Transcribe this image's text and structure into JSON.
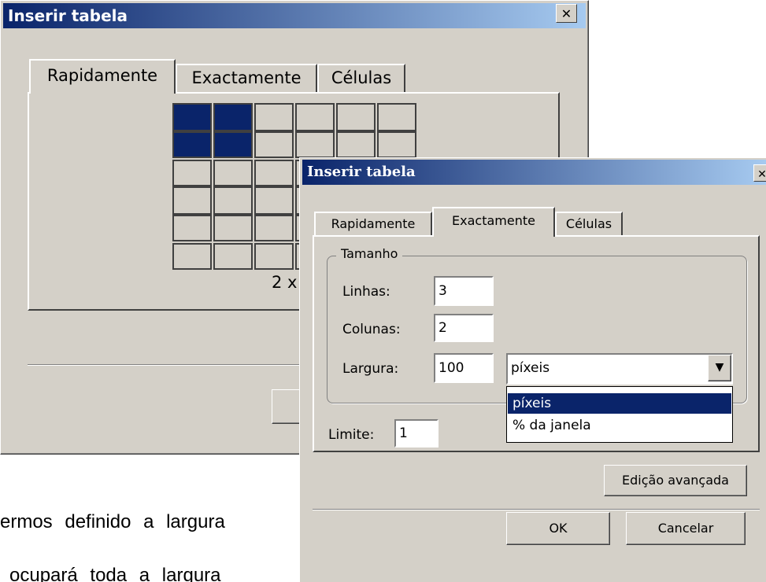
{
  "dialog1": {
    "title": "Inserir tabela",
    "close_glyph": "✕",
    "tabs": [
      "Rapidamente",
      "Exactamente",
      "Células"
    ],
    "grid_rows": 6,
    "grid_cols": 6,
    "selected_rows": 2,
    "selected_cols": 2,
    "size_label": "2 x"
  },
  "dialog2": {
    "title": "Inserir tabela",
    "close_glyph": "✕",
    "tabs": [
      "Rapidamente",
      "Exactamente",
      "Células"
    ],
    "group_title": "Tamanho",
    "fields": {
      "linhas_label": "Linhas:",
      "linhas_value": "3",
      "colunas_label": "Colunas:",
      "colunas_value": "2",
      "largura_label": "Largura:",
      "largura_value": "100",
      "unit_selected": "píxeis"
    },
    "unit_options": [
      "píxeis",
      "% da janela"
    ],
    "limite_label": "Limite:",
    "limite_value": "1",
    "advanced_button": "Edição avançada",
    "ok_button": "OK",
    "cancel_button": "Cancelar"
  },
  "body_text": {
    "line1": "ermos definido a largura",
    "line2": "ocupará toda a largura"
  }
}
